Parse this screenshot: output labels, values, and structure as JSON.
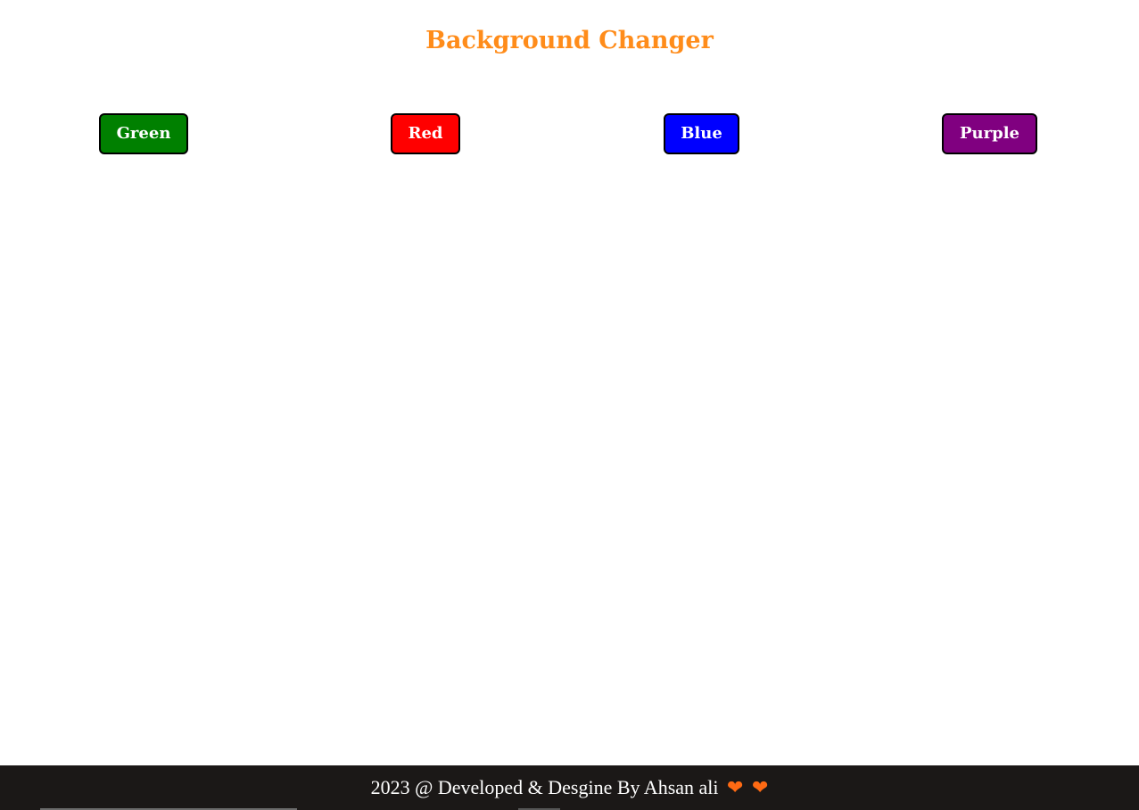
{
  "page": {
    "title": "Background Changer",
    "title_color": "#ff8c1a",
    "background_color": "#ffffff"
  },
  "buttons": [
    {
      "label": "Green",
      "color": "#008000"
    },
    {
      "label": "Red",
      "color": "#ff0000"
    },
    {
      "label": "Blue",
      "color": "#0000ff"
    },
    {
      "label": "Purple",
      "color": "#800080"
    }
  ],
  "footer": {
    "text": "2023 @ Developed & Desgine By Ahsan ali",
    "icons": [
      "heart-icon",
      "heart-icon"
    ],
    "heart_color": "#ff6a13",
    "background_color": "#1b1817"
  }
}
